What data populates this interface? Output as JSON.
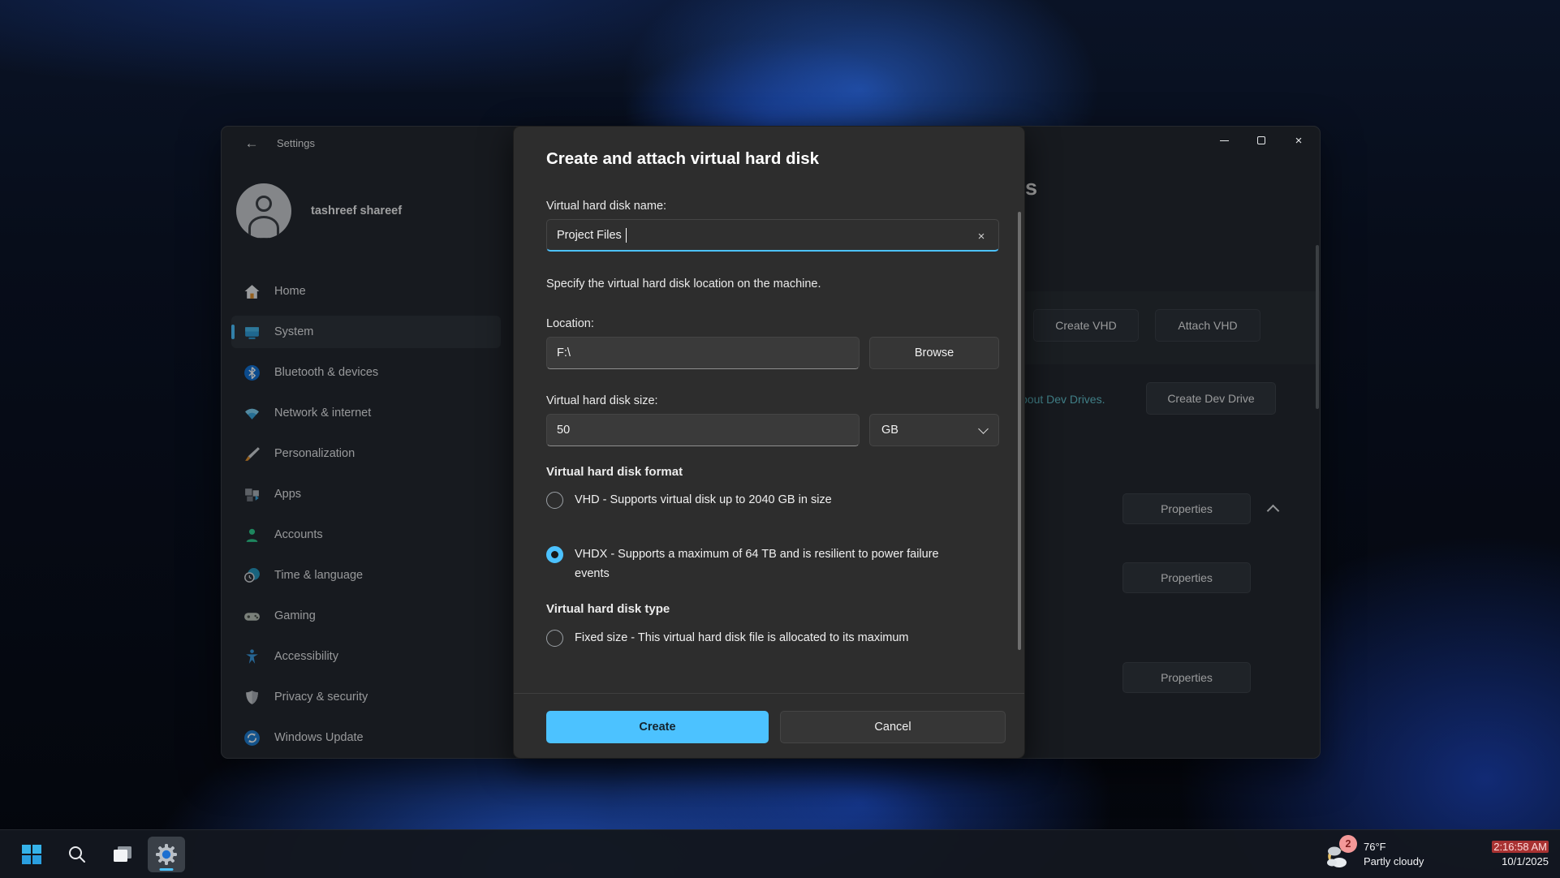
{
  "window": {
    "title": "Settings"
  },
  "icons": {
    "back_glyph": "←",
    "clear_glyph": "×",
    "close_glyph": "×"
  },
  "sidebar": {
    "user": {
      "name": "tashreef shareef"
    },
    "items": [
      {
        "label": "Home",
        "selected": false
      },
      {
        "label": "System",
        "selected": true
      },
      {
        "label": "Bluetooth & devices",
        "selected": false
      },
      {
        "label": "Network & internet",
        "selected": false
      },
      {
        "label": "Personalization",
        "selected": false
      },
      {
        "label": "Apps",
        "selected": false
      },
      {
        "label": "Accounts",
        "selected": false
      },
      {
        "label": "Time & language",
        "selected": false
      },
      {
        "label": "Gaming",
        "selected": false
      },
      {
        "label": "Accessibility",
        "selected": false
      },
      {
        "label": "Privacy & security",
        "selected": false
      },
      {
        "label": "Windows Update",
        "selected": false
      }
    ]
  },
  "content": {
    "heading_fragment": "s",
    "create_vhd_label": "Create VHD",
    "attach_vhd_label": "Attach VHD",
    "dev_drive_link_fragment": "bout Dev Drives.",
    "create_dev_drive_label": "Create Dev Drive",
    "properties": [
      "Properties",
      "Properties",
      "Properties"
    ]
  },
  "dialog": {
    "title": "Create and attach virtual hard disk",
    "name_label": "Virtual hard disk name:",
    "name_value": "Project Files",
    "location_intro": "Specify the virtual hard disk location on the machine.",
    "location_label": "Location:",
    "location_value": "F:\\",
    "browse_label": "Browse",
    "size_label": "Virtual hard disk size:",
    "size_value": "50",
    "size_unit": "GB",
    "format_heading": "Virtual hard disk format",
    "format_options": [
      {
        "label": "VHD - Supports virtual disk up to 2040 GB in size",
        "selected": false
      },
      {
        "label": "VHDX - Supports a maximum of 64 TB and is resilient to power failure events",
        "selected": true
      }
    ],
    "type_heading": "Virtual hard disk type",
    "type_options": [
      {
        "label": "Fixed size - This virtual hard disk file is allocated to its maximum",
        "selected": false
      }
    ],
    "create_label": "Create",
    "cancel_label": "Cancel"
  },
  "taskbar": {
    "tray": {
      "badge_count": "2",
      "temperature": "76°F",
      "condition": "Partly cloudy",
      "time": "2:16:58 AM",
      "date": "10/1/2025"
    }
  },
  "colors": {
    "accent": "#4cc2ff",
    "link": "#61c0cb",
    "badge": "#f49898",
    "time_highlight": "#a83232"
  }
}
